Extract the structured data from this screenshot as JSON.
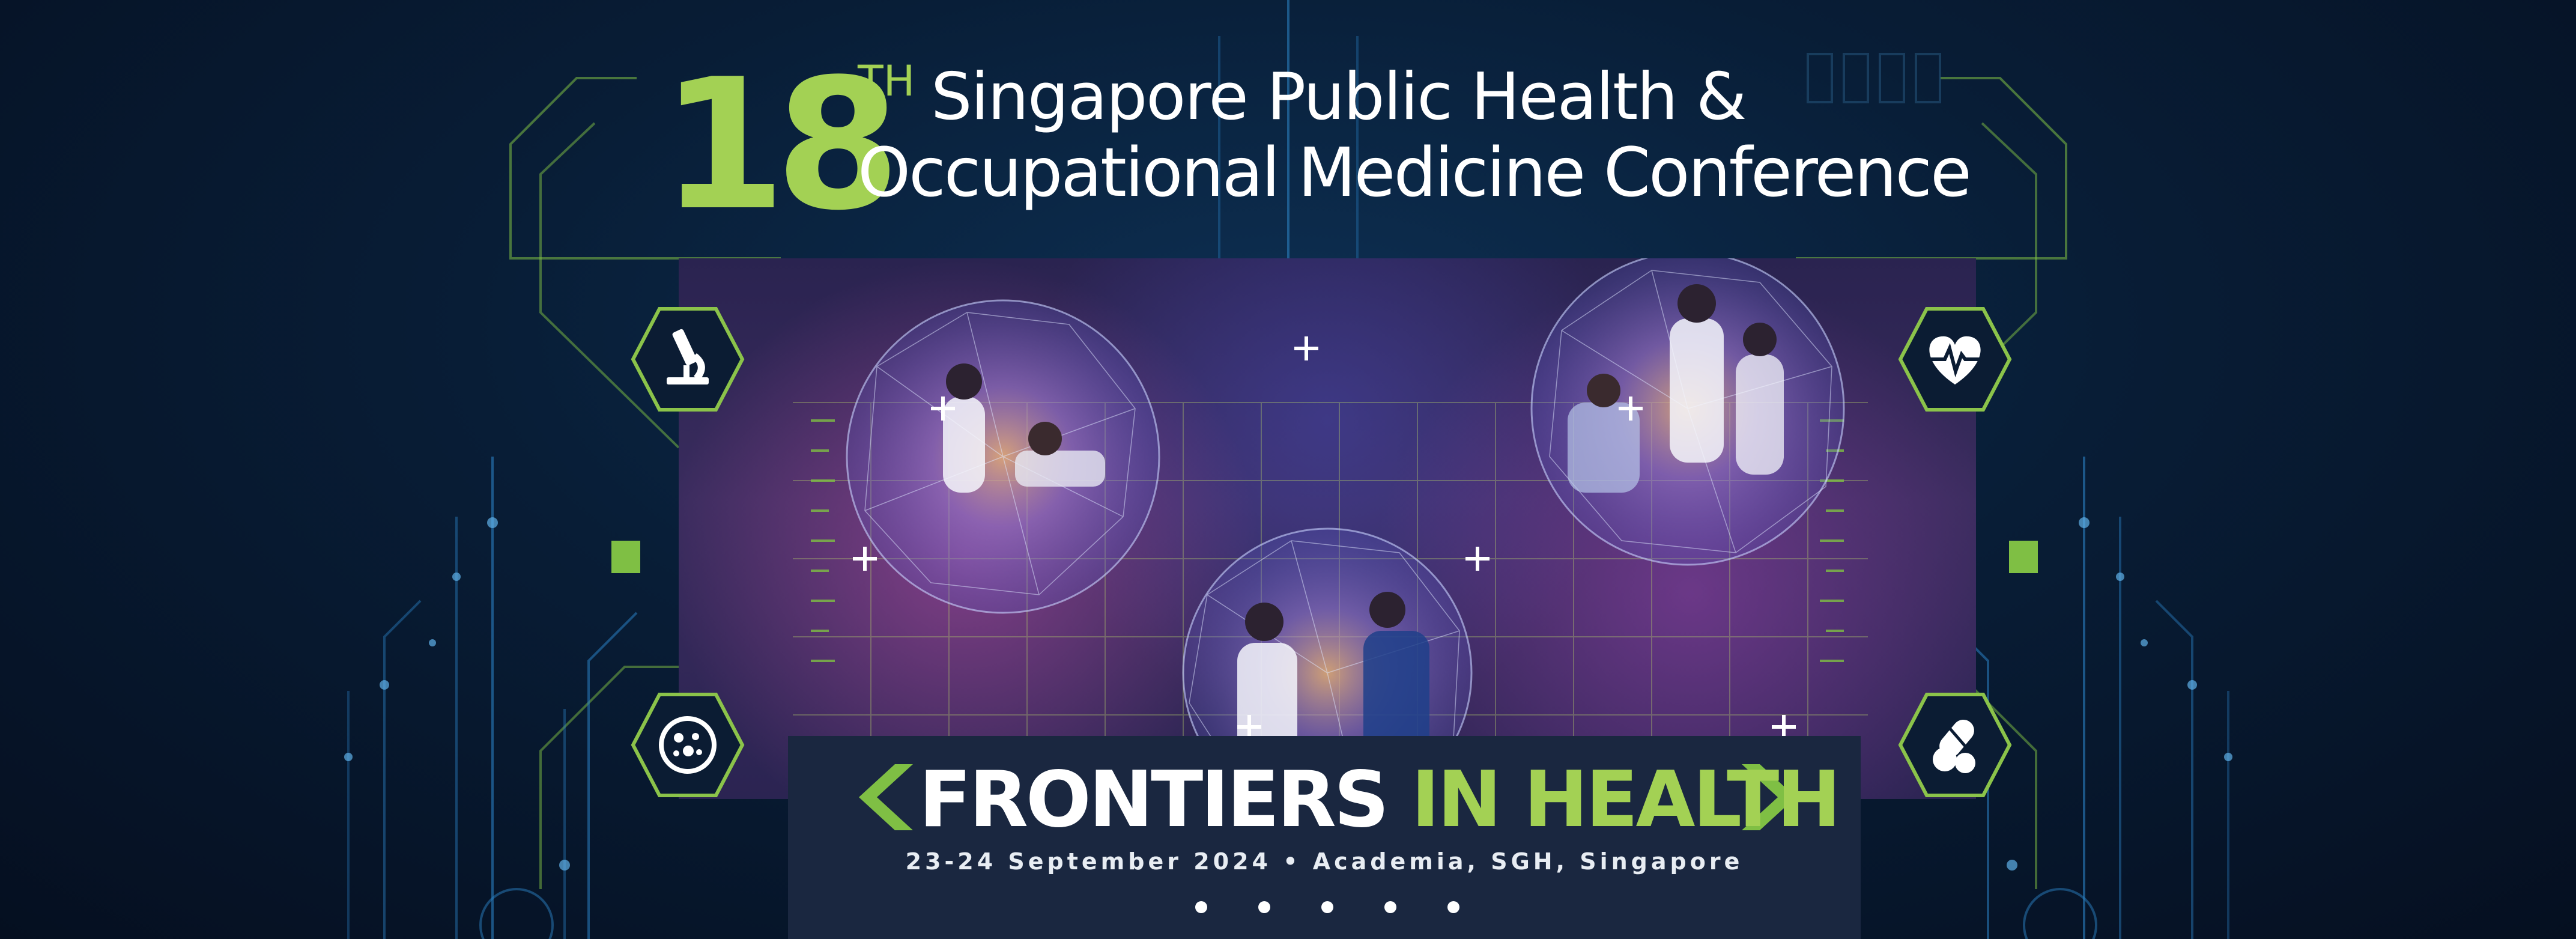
{
  "header": {
    "edition_number": "18",
    "edition_suffix": "TH",
    "title_line_1": "Singapore Public Health &",
    "title_line_2": "Occupational Medicine Conference"
  },
  "banner": {
    "theme_white": "FRONTIERS ",
    "theme_green": "IN HEALTH",
    "event_details": "23-24 September 2024 • Academia, SGH, Singapore"
  },
  "carousel": {
    "slide_count": 5
  },
  "icons": {
    "top_left": "microscope-icon",
    "bottom_left": "petri-dish-icon",
    "top_right": "heartbeat-icon",
    "bottom_right": "pills-icon"
  },
  "colors": {
    "accent_green": "#a3d154",
    "background": "#081d36",
    "banner": "#1a2740"
  }
}
